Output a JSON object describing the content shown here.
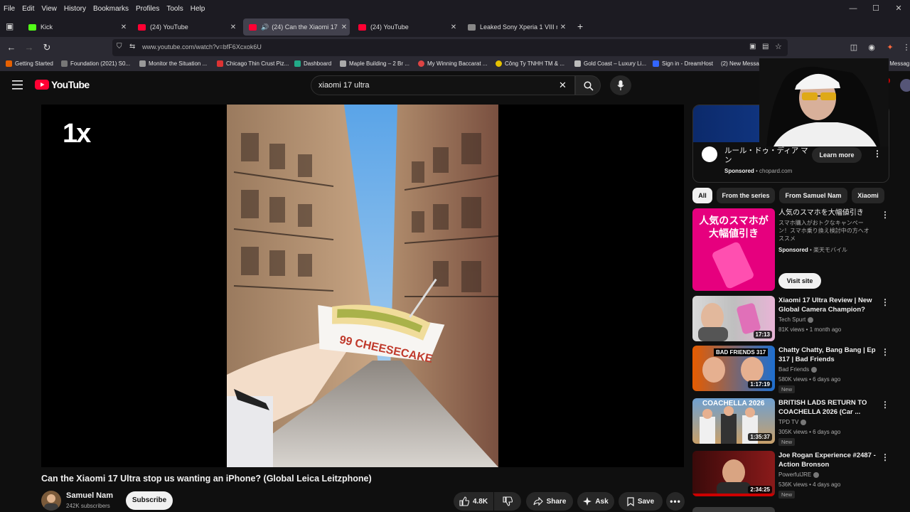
{
  "browser": {
    "menu": [
      "File",
      "Edit",
      "View",
      "History",
      "Bookmarks",
      "Profiles",
      "Tools",
      "Help"
    ],
    "tabs": [
      {
        "title": "Kick",
        "color": "#53fc18"
      },
      {
        "title": "(24) YouTube",
        "color": "#ff0033"
      },
      {
        "title": "(24) Can the Xiaomi 17 Ultr",
        "color": "#ff0033"
      },
      {
        "title": "(24) YouTube",
        "color": "#ff0033"
      },
      {
        "title": "Leaked Sony Xperia 1 VIII rend",
        "color": "#888888"
      }
    ],
    "url": "www.youtube.com/watch?v=bfF6Xcxok6U",
    "bookmarks": [
      "Getting Started",
      "Foundation (2021) S0...",
      "Monitor the Situation ...",
      "Chicago Thin Crust Piz...",
      "Dashboard",
      "Maple Building – 2 Br ...",
      "My Winning Baccarat ...",
      "Công Ty TNHH TM & ...",
      "Gold Coast – Luxury Li...",
      "Sign in - DreamHost",
      "(2) New Message!",
      "Vo",
      "(1) New Messag"
    ]
  },
  "youtube": {
    "logo": "YouTube",
    "search_query": "xiaomi 17 ultra",
    "create_label": "eate",
    "notif_count": "9+"
  },
  "player": {
    "speed_label": "1x",
    "overlay_text": "99 CHEESECAKE"
  },
  "video": {
    "title": "Can the Xiaomi 17 Ultra stop us wanting an iPhone? (Global Leica Leitzphone)",
    "channel": "Samuel Nam",
    "subscribers": "242K subscribers",
    "subscribe_label": "Subscribe",
    "likes": "4.8K",
    "share_label": "Share",
    "ask_label": "Ask",
    "save_label": "Save"
  },
  "ad": {
    "title": "ルール・ドゥ・ディア マン",
    "sponsored": "Sponsored",
    "domain": "chopard.com",
    "cta": "Learn more"
  },
  "chips": [
    "All",
    "From the series",
    "From Samuel Nam",
    "Xiaomi"
  ],
  "ad2": {
    "thumb_text": "人気のスマホが 大幅値引き",
    "title": "人気のスマホを大幅値引き",
    "desc": "スマホ購入がおトクなキャンペーン！スマホ乗り換え検討中の方へオススメ",
    "sponsored": "Sponsored",
    "advertiser": "楽天モバイル",
    "cta": "Visit site"
  },
  "recommendations": [
    {
      "title": "Xiaomi 17 Ultra Review | New Global Camera Champion?",
      "channel": "Tech Spurt",
      "meta": "81K views • 1 month ago",
      "duration": "17:13",
      "new": ""
    },
    {
      "title": "Chatty Chatty, Bang Bang | Ep 317 | Bad Friends",
      "channel": "Bad Friends",
      "meta": "580K views • 6 days ago",
      "duration": "1:17:19",
      "new": "New",
      "thumb_text": "BAD FRIENDS 317"
    },
    {
      "title": "BRITISH LADS RETURN TO COACHELLA 2026 (Car ...",
      "channel": "TPD TV",
      "meta": "305K views • 6 days ago",
      "duration": "1:35:37",
      "new": "New",
      "thumb_text": "COACHELLA 2026"
    },
    {
      "title": "Joe Rogan Experience #2487 - Action Bronson",
      "channel": "PowerfulJRE",
      "meta": "536K views • 4 days ago",
      "duration": "2:34:25",
      "new": "New"
    }
  ]
}
